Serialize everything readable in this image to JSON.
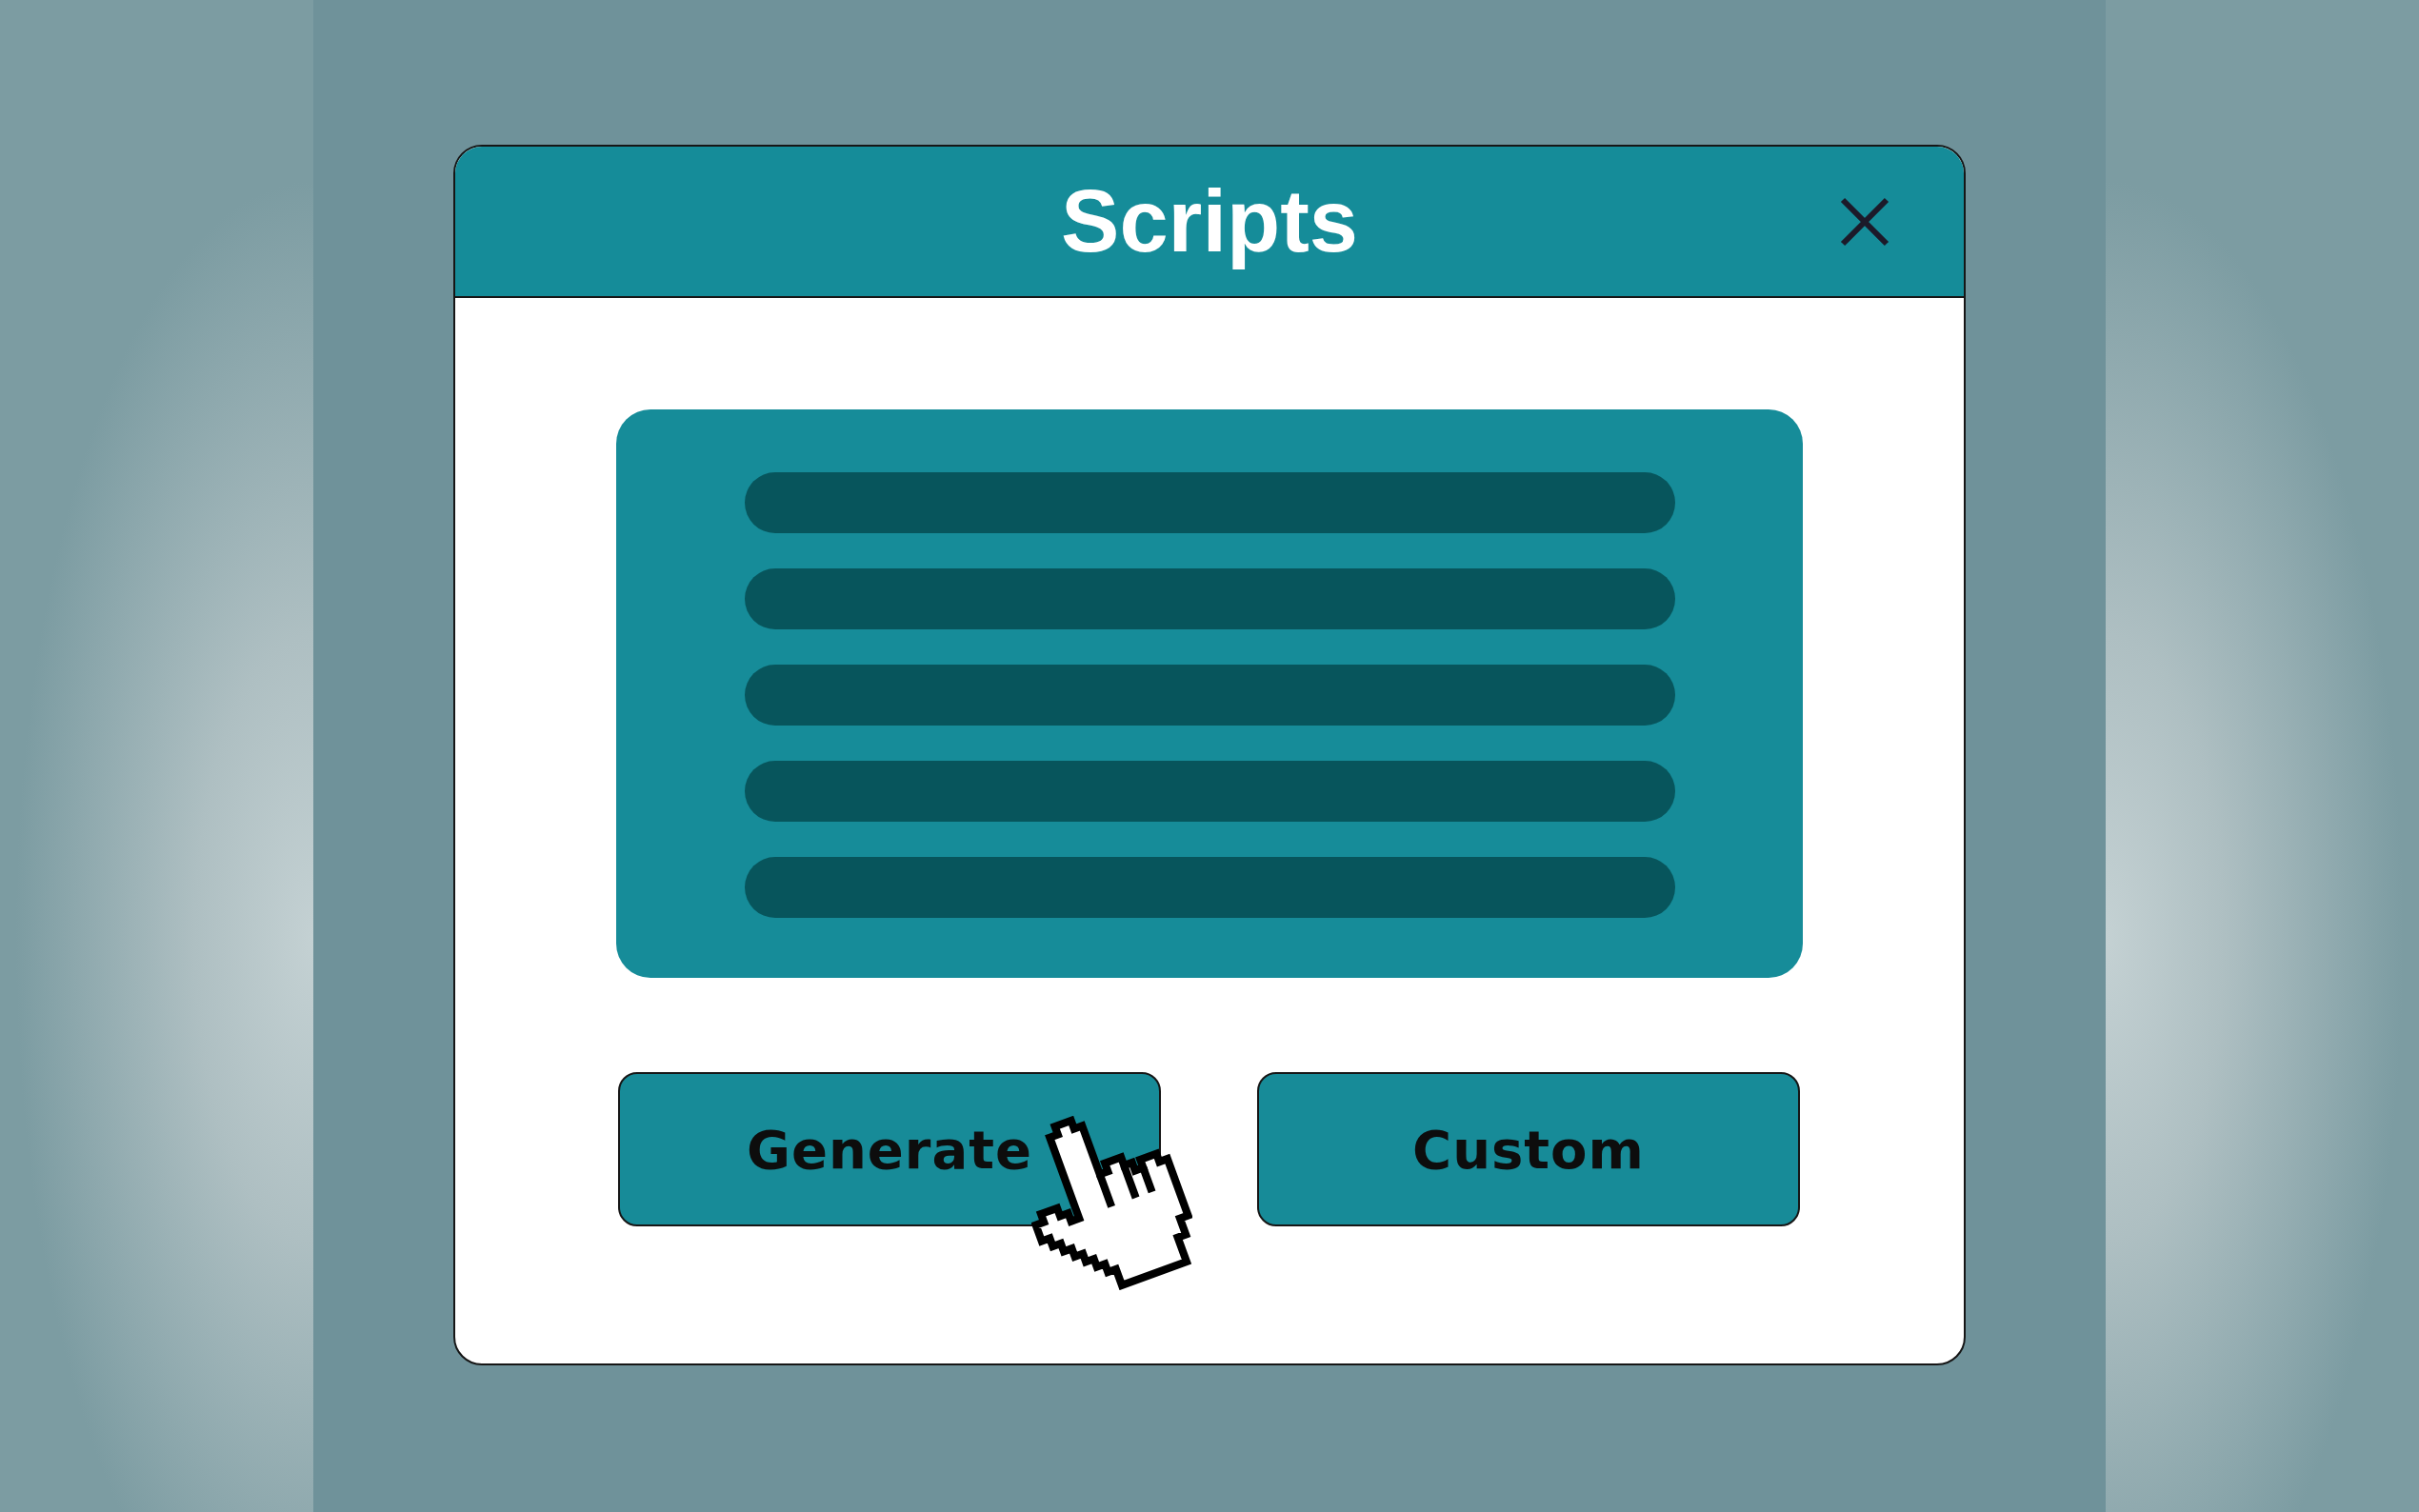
{
  "window": {
    "title": "Scripts"
  },
  "buttons": [
    {
      "label": "Generate",
      "hovered": true
    },
    {
      "label": "Custom",
      "hovered": false
    }
  ]
}
